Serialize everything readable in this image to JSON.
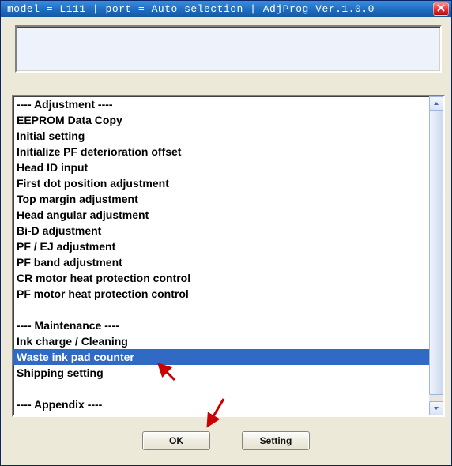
{
  "titlebar": {
    "text": "model = L111 | port = Auto selection | AdjProg Ver.1.0.0"
  },
  "list": {
    "items": [
      {
        "label": "---- Adjustment ----",
        "selected": false
      },
      {
        "label": "EEPROM Data Copy",
        "selected": false
      },
      {
        "label": "Initial setting",
        "selected": false
      },
      {
        "label": "Initialize PF deterioration offset",
        "selected": false
      },
      {
        "label": "Head ID input",
        "selected": false
      },
      {
        "label": "First dot position adjustment",
        "selected": false
      },
      {
        "label": "Top margin adjustment",
        "selected": false
      },
      {
        "label": "Head angular adjustment",
        "selected": false
      },
      {
        "label": "Bi-D adjustment",
        "selected": false
      },
      {
        "label": "PF / EJ adjustment",
        "selected": false
      },
      {
        "label": "PF band adjustment",
        "selected": false
      },
      {
        "label": "CR motor heat protection control",
        "selected": false
      },
      {
        "label": "PF motor heat protection control",
        "selected": false
      },
      {
        "label": "",
        "selected": false
      },
      {
        "label": "---- Maintenance ----",
        "selected": false
      },
      {
        "label": "Ink charge / Cleaning",
        "selected": false
      },
      {
        "label": "Waste ink pad counter",
        "selected": true
      },
      {
        "label": "Shipping setting",
        "selected": false
      },
      {
        "label": "",
        "selected": false
      },
      {
        "label": "---- Appendix ----",
        "selected": false
      }
    ]
  },
  "buttons": {
    "ok": "OK",
    "setting": "Setting"
  },
  "annotations": {
    "arrow_color": "#cc0000"
  }
}
